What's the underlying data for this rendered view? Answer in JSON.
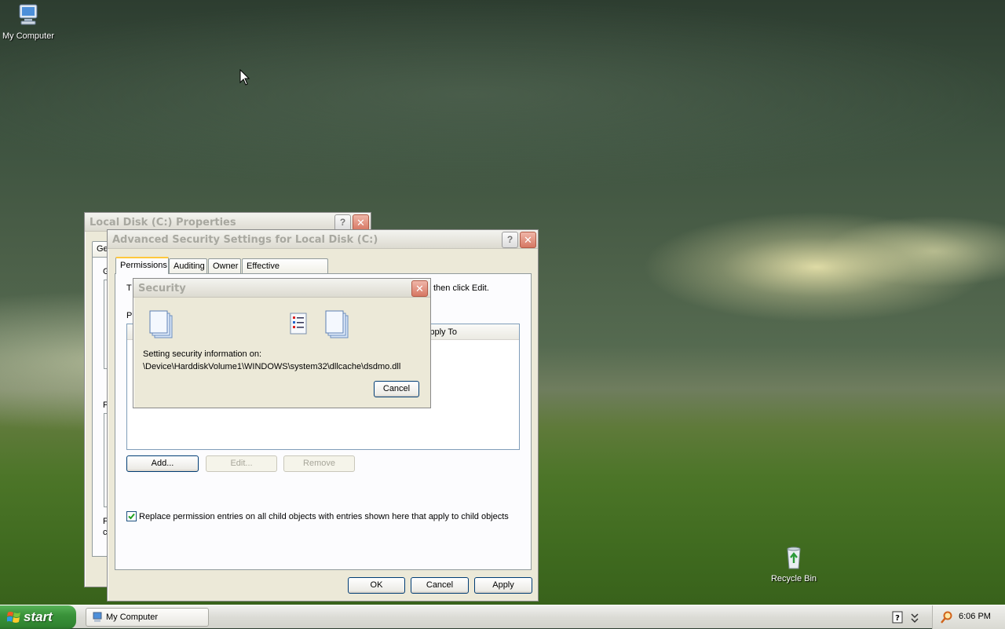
{
  "desktop": {
    "icons": [
      {
        "label": "My Computer",
        "icon": "my-computer-icon"
      },
      {
        "label": "Recycle Bin",
        "icon": "recycle-bin-icon"
      }
    ]
  },
  "properties_window": {
    "title": "Local Disk (C:) Properties",
    "tab_partial": "Ge",
    "left_letters": [
      "G",
      "F",
      "F",
      "c"
    ]
  },
  "advanced_window": {
    "title": "Advanced Security Settings for Local Disk (C:)",
    "tabs": [
      "Permissions",
      "Auditing",
      "Owner",
      "Effective Permissions"
    ],
    "intro_partial_start": "T",
    "intro_partial_end": "then click Edit.",
    "list_label_partial": "P",
    "list_header_apply_to": "Apply To",
    "buttons": {
      "add": "Add...",
      "edit": "Edit...",
      "remove": "Remove"
    },
    "checkbox_label": "Replace permission entries on all child objects with entries shown here that apply to child objects",
    "checkbox_checked": true,
    "footer": {
      "ok": "OK",
      "cancel": "Cancel",
      "apply": "Apply"
    }
  },
  "security_dialog": {
    "title": "Security",
    "message_line1": "Setting security information on:",
    "message_line2": "\\Device\\HarddiskVolume1\\WINDOWS\\system32\\dllcache\\dsdmo.dll",
    "cancel": "Cancel"
  },
  "taskbar": {
    "start_label": "start",
    "task_item": "My Computer",
    "clock": "6:06 PM"
  }
}
